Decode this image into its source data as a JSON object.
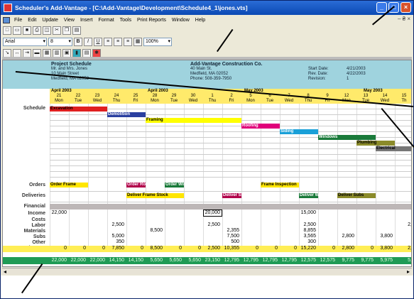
{
  "window": {
    "title": "Scheduler's Add-Vantage - [C:\\Add-Vantage\\Development\\Schedule4_1\\jones.vts]"
  },
  "menu": [
    "File",
    "Edit",
    "Update",
    "View",
    "Insert",
    "Format",
    "Tools",
    "Print Reports",
    "Window",
    "Help"
  ],
  "toolbar": {
    "font": "Arial",
    "size": "8",
    "zoom": "100%"
  },
  "header": {
    "left_title": "Project Schedule",
    "left_lines": [
      "Mr. and Mrs. Jones",
      "10 Main Street",
      "Medfield, MA 02052"
    ],
    "mid_title": "Add-Vantage Construction Co.",
    "mid_lines": [
      "40 Main St.",
      "Medfield, MA 02052",
      "Phone: 508-359-7950"
    ],
    "right_labels": [
      "Start Date:",
      "Rev. Date:",
      "Revision:"
    ],
    "right_values": [
      "4/21/2003",
      "4/22/2003",
      "1"
    ]
  },
  "months": [
    "April 2003",
    "April 2003",
    "May 2003",
    "May 2003"
  ],
  "days": [
    [
      "21",
      "Mon"
    ],
    [
      "22",
      "Tue"
    ],
    [
      "23",
      "Wed"
    ],
    [
      "24",
      "Thu"
    ],
    [
      "25",
      "Fri"
    ],
    [
      "28",
      "Mon"
    ],
    [
      "29",
      "Tue"
    ],
    [
      "30",
      "Wed"
    ],
    [
      "1",
      "Thu"
    ],
    [
      "2",
      "Fri"
    ],
    [
      "5",
      "Mon"
    ],
    [
      "6",
      "Tue"
    ],
    [
      "7",
      "Wed"
    ],
    [
      "8",
      "Thu"
    ],
    [
      "9",
      "Fri"
    ],
    [
      "12",
      "Mon"
    ],
    [
      "13",
      "Tue"
    ],
    [
      "14",
      "Wed"
    ],
    [
      "15",
      "Th"
    ]
  ],
  "rows": {
    "schedule": "Schedule",
    "orders": "Orders",
    "deliveries": "Deliveries",
    "financial": "Financial",
    "income": "Income",
    "costs": "Costs",
    "labor": "Labor",
    "materials": "Materials",
    "subs": "Subs",
    "other": "Other",
    "total": "Total Costs",
    "job": "Job Balance"
  },
  "tasks": [
    "Excavation",
    "Demolition",
    "Framing",
    "Roofing",
    "Siding",
    "Windows",
    "Plumbing",
    "Electrical"
  ],
  "orders": [
    "Order Frame",
    "Order Roof",
    "Order Windows",
    "Frame Inspection"
  ],
  "deliveries": [
    "Deliver Frame Stock",
    "Deliver Shingles",
    "Deliver Windows",
    "Deliver Subs"
  ],
  "income": [
    "22,000",
    "20,000",
    "15,000"
  ],
  "labor": [
    "2,500",
    "2,500",
    "2,500",
    "2,"
  ],
  "materials": [
    "8,500",
    "2,355",
    "8,855"
  ],
  "subs": [
    "5,000",
    "7,500",
    "3,565",
    "2,800",
    "3,800"
  ],
  "other": [
    "350",
    "500",
    "300"
  ],
  "totals": [
    "0",
    "0",
    "0",
    "7,850",
    "0",
    "8,500",
    "0",
    "0",
    "2,500",
    "10,355",
    "0",
    "0",
    "0",
    "15,220",
    "0",
    "2,800",
    "0",
    "3,800",
    "2,"
  ],
  "job_balance": [
    "22,000",
    "22,000",
    "22,000",
    "14,150",
    "14,150",
    "5,650",
    "5,650",
    "5,650",
    "23,150",
    "12,795",
    "12,795",
    "12,795",
    "12,795",
    "12,575",
    "12,575",
    "9,775",
    "9,775",
    "5,975",
    "5,"
  ]
}
